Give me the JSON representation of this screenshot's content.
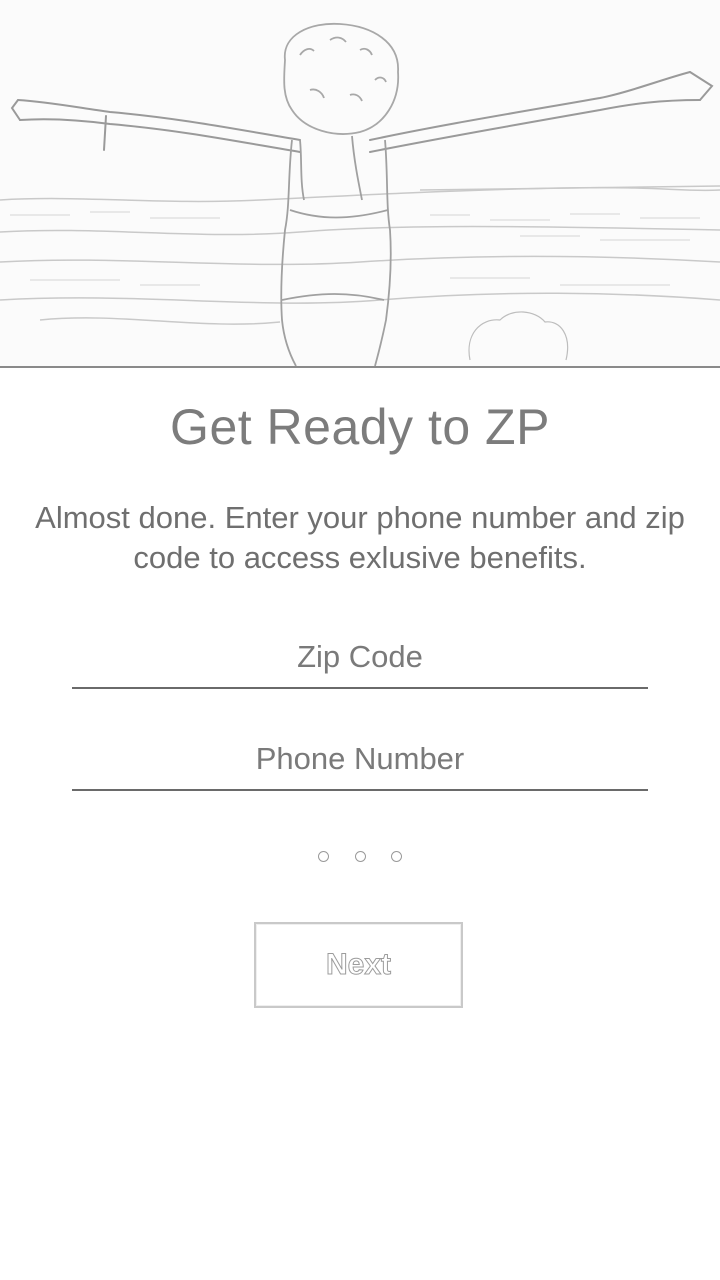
{
  "hero": {
    "image": "woman-arms-outstretched-landscape"
  },
  "heading": {
    "title": "Get Ready to ZP",
    "subtitle": "Almost done. Enter your phone number and zip code to access exlusive benefits."
  },
  "form": {
    "zip_placeholder": "Zip Code",
    "zip_value": "",
    "phone_placeholder": "Phone Number",
    "phone_value": ""
  },
  "pager": {
    "total": 3
  },
  "actions": {
    "next_label": "Next"
  }
}
